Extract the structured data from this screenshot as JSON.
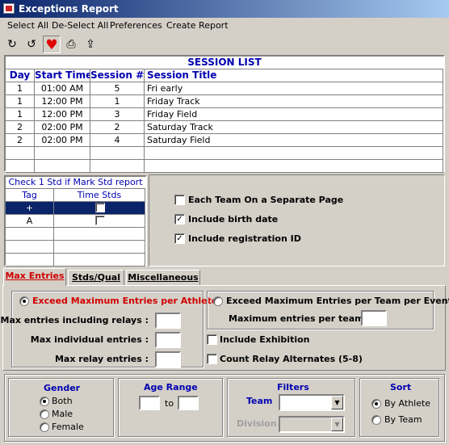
{
  "window": {
    "title": "Exceptions Report"
  },
  "menu": [
    "Select All",
    "De-Select All",
    "Preferences",
    "Create Report"
  ],
  "toolbar": {
    "icons": [
      "redo-icon",
      "undo-icon",
      "heart-icon",
      "printer-icon",
      "folder-up-icon"
    ]
  },
  "session_list": {
    "title": "SESSION LIST",
    "columns": [
      "Day",
      "Start Time",
      "Session #",
      "Session Title"
    ],
    "rows": [
      [
        "1",
        "01:00 AM",
        "5",
        "Fri early"
      ],
      [
        "1",
        "12:00 PM",
        "1",
        "Friday Track"
      ],
      [
        "1",
        "12:00 PM",
        "3",
        "Friday Field"
      ],
      [
        "2",
        "02:00 PM",
        "2",
        "Saturday Track"
      ],
      [
        "2",
        "02:00 PM",
        "4",
        "Saturday Field"
      ]
    ]
  },
  "std_grid": {
    "title": "Check 1 Std if Mark Std report",
    "columns": [
      "Tag",
      "Time Stds"
    ],
    "rows": [
      {
        "tag": "+",
        "checked": false,
        "selected": true
      },
      {
        "tag": "A",
        "checked": false,
        "selected": false
      }
    ]
  },
  "page_options": [
    {
      "label": "Each Team On a Separate Page",
      "checked": false
    },
    {
      "label": "Include birth date",
      "checked": true
    },
    {
      "label": "Include registration ID",
      "checked": true
    }
  ],
  "tabs": [
    "Max Entries",
    "Stds/Qual",
    "Miscellaneous"
  ],
  "max_entries": {
    "athlete_radio": "Exceed Maximum Entries per Athlete",
    "team_radio": "Exceed Maximum Entries per Team per Event",
    "incl_relays": "Max entries including relays :",
    "individual": "Max individual entries :",
    "relay": "Max relay entries :",
    "per_team": "Maximum entries per team :",
    "include_exhibition": "Include Exhibition",
    "count_relay_alternates": "Count Relay Alternates (5-8)"
  },
  "gender": {
    "title": "Gender",
    "options": [
      "Both",
      "Male",
      "Female"
    ],
    "selected": "Both"
  },
  "age_range": {
    "title": "Age Range",
    "to": "to"
  },
  "filters": {
    "title": "Filters",
    "team": "Team",
    "division": "Division"
  },
  "sort": {
    "title": "Sort",
    "options": [
      "By Athlete",
      "By Team"
    ],
    "selected": "By Athlete"
  }
}
